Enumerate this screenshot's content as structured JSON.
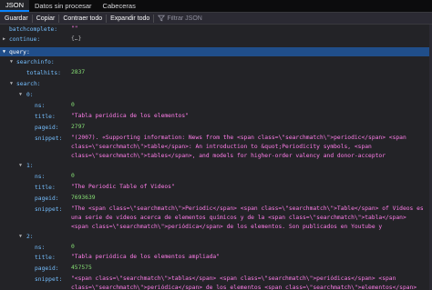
{
  "tabs": [
    "JSON",
    "Datos sin procesar",
    "Cabeceras"
  ],
  "toolbar": {
    "save": "Guardar",
    "copy": "Copiar",
    "collapse_all": "Contraer todo",
    "expand_all": "Expandir todo",
    "filter_placeholder": "Filtrar JSON"
  },
  "tree": {
    "batchcomplete": {
      "key": "batchcomplete:",
      "value": "\"\""
    },
    "continue": {
      "key": "continue:",
      "value": "{…}"
    },
    "query": {
      "key": "query:"
    },
    "searchinfo": {
      "key": "searchinfo:"
    },
    "totalhits": {
      "key": "totalhits:",
      "value": "2837"
    },
    "search": {
      "key": "search:"
    },
    "results": [
      {
        "index": "0:",
        "ns_key": "ns:",
        "ns": "0",
        "title_key": "title:",
        "title": "\"Tabla periódica de los elementos\"",
        "pageid_key": "pageid:",
        "pageid": "2797",
        "snippet_key": "snippet:",
        "snippet": "\"(2007). «Supporting information: News from the <span class=\\\"searchmatch\\\">periodic</span> <span class=\\\"searchmatch\\\">table</span>: An introduction to &quot;Periodicity symbols, <span class=\\\"searchmatch\\\">tables</span>, and models for higher-order valency and donor-acceptor"
      },
      {
        "index": "1:",
        "ns_key": "ns:",
        "ns": "0",
        "title_key": "title:",
        "title": "\"The Periodic Table of Videos\"",
        "pageid_key": "pageid:",
        "pageid": "7693639",
        "snippet_key": "snippet:",
        "snippet": "\"The <span class=\\\"searchmatch\\\">Periodic</span> <span class=\\\"searchmatch\\\">Table</span> of Videos es una serie de vídeos acerca de elementos químicos y de la <span class=\\\"searchmatch\\\">tabla</span> <span class=\\\"searchmatch\\\">periódica</span> de los elementos. Son publicados en Youtube y"
      },
      {
        "index": "2:",
        "ns_key": "ns:",
        "ns": "0",
        "title_key": "title:",
        "title": "\"Tabla periódica de los elementos ampliada\"",
        "pageid_key": "pageid:",
        "pageid": "457575",
        "snippet_key": "snippet:",
        "snippet": "\"<span class=\\\"searchmatch\\\">tablas</span> <span class=\\\"searchmatch\\\">periódicas</span> <span class=\\\"searchmatch\\\">periódica</span> de los elementos <span class=\\\"searchmatch\\\">elementos</span>"
      }
    ]
  },
  "colors": {
    "background": "#232327",
    "selection": "#204e8a",
    "key": "#75bfff",
    "string": "#ff7de9",
    "number": "#86de74"
  },
  "icons": {
    "expanded": "triangle-down-icon",
    "collapsed": "triangle-right-icon",
    "filter": "funnel-icon"
  }
}
